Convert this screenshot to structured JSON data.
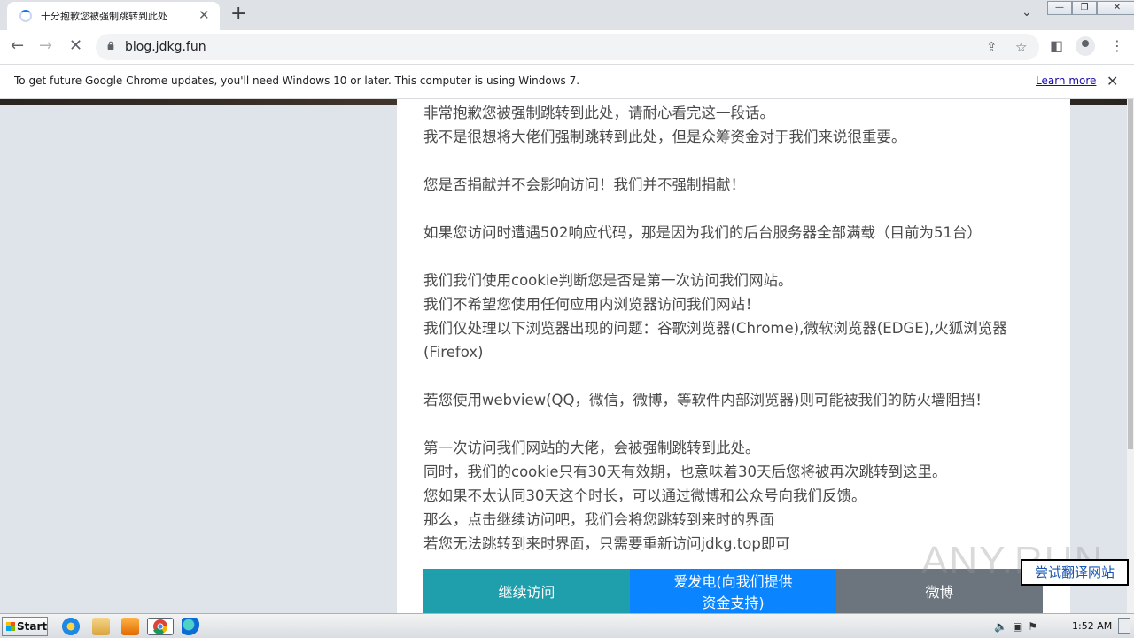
{
  "browser": {
    "tab_title": "十分抱歉您被强制跳转到此处",
    "tab_close": "✕",
    "new_tab": "+",
    "url": "blog.jdkg.fun",
    "back": "←",
    "forward": "→",
    "reload": "✕",
    "win_min": "—",
    "win_max": "❐",
    "win_close": "✕"
  },
  "infobar": {
    "message": "To get future Google Chrome updates, you'll need Windows 10 or later. This computer is using Windows 7.",
    "learn_more": "Learn more",
    "close": "✕"
  },
  "content": {
    "lines": [
      "非常抱歉您被强制跳转到此处，请耐心看完这一段话。",
      "我不是很想将大佬们强制跳转到此处，但是众筹资金对于我们来说很重要。",
      "",
      "您是否捐献并不会影响访问！我们并不强制捐献！",
      "",
      "如果您访问时遭遇502响应代码，那是因为我们的后台服务器全部满载（目前为51台）",
      "",
      "我们我们使用cookie判断您是否是第一次访问我们网站。",
      "我们不希望您使用任何应用内浏览器访问我们网站！",
      "我们仅处理以下浏览器出现的问题：谷歌浏览器(Chrome),微软浏览器(EDGE),火狐浏览器(Firefox)",
      "",
      "若您使用webview(QQ，微信，微博，等软件内部浏览器)则可能被我们的防火墙阻挡！",
      "",
      "第一次访问我们网站的大佬，会被强制跳转到此处。",
      "同时，我们的cookie只有30天有效期，也意味着30天后您将被再次跳转到这里。",
      "您如果不太认同30天这个时长，可以通过微博和公众号向我们反馈。",
      "那么，点击继续访问吧，我们会将您跳转到来时的界面",
      "若您无法跳转到来时界面，只需要重新访问jdkg.top即可"
    ],
    "buttons": {
      "continue": "继续访问",
      "donate_line1": "爱发电(向我们提供",
      "donate_line2": "资金支持)",
      "weibo": "微博"
    },
    "translate": "尝试翻译网站",
    "watermark": "ANY.RUN"
  },
  "taskbar": {
    "start": "Start",
    "clock": "1:52 AM"
  },
  "colors": {
    "btn_continue": "#1e9fab",
    "btn_donate": "#0a84ff",
    "btn_weibo": "#6c757d"
  }
}
